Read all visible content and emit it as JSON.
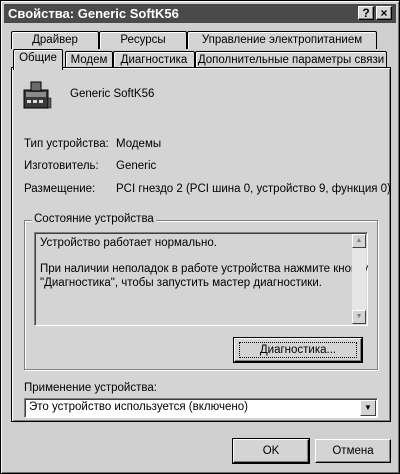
{
  "window": {
    "title": "Свойства: Generic SoftK56",
    "help_glyph": "?",
    "close_glyph": "×"
  },
  "tabs": {
    "row1": [
      "Драйвер",
      "Ресурсы",
      "Управление электропитанием"
    ],
    "row2": [
      "Общие",
      "Модем",
      "Диагностика",
      "Дополнительные параметры связи"
    ],
    "active": "Общие"
  },
  "device": {
    "name": "Generic SoftK56",
    "icon": "modem-phone-icon",
    "type_label": "Тип устройства:",
    "type_value": "Модемы",
    "manufacturer_label": "Изготовитель:",
    "manufacturer_value": "Generic",
    "location_label": "Размещение:",
    "location_value": "PCI гнездо 2 (PCI шина 0, устройство 9, функция 0)"
  },
  "status": {
    "group_label": "Состояние устройства",
    "lines": [
      "Устройство работает нормально.",
      "",
      "При наличии неполадок в работе устройства нажмите кнопку",
      "\"Диагностика\", чтобы запустить мастер диагностики."
    ],
    "diagnostics_button": "Диагностика..."
  },
  "usage": {
    "label": "Применение устройства:",
    "selected": "Это устройство используется (включено)"
  },
  "footer": {
    "ok_label": "OK",
    "cancel_label": "Отмена"
  }
}
